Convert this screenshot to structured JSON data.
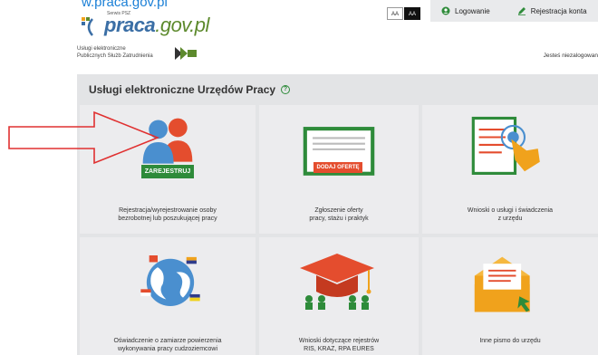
{
  "top_link": "w.praca.gov.pl",
  "logo": {
    "small_text": "Serwis PSZ",
    "brand_main": "praca",
    "brand_domain": ".gov.pl",
    "subtitle_line1": "Usługi elektroniczne",
    "subtitle_line2": "Publicznych Służb Zatrudnienia"
  },
  "font_size": {
    "normal": "AA",
    "contrast": "AA"
  },
  "topbar": {
    "login": "Logowanie",
    "register": "Rejestracja konta"
  },
  "status_text": "Jesteś niezalogowan",
  "panel": {
    "title": "Usługi elektroniczne Urzędów Pracy",
    "help_glyph": "?"
  },
  "tiles": [
    {
      "label": "Rejestracja/wyrejestrowanie osoby\nbezrobotnej lub poszukującej pracy",
      "button": "ZAREJESTRUJ"
    },
    {
      "label": "Zgłoszenie oferty\npracy, stażu i praktyk",
      "button": "DODAJ OFERTĘ"
    },
    {
      "label": "Wnioski o usługi i świadczenia\nz urzędu"
    },
    {
      "label": "Oświadczenie o zamiarze powierzenia\nwykonywania pracy cudzoziemcowi"
    },
    {
      "label": "Wnioski dotyczące rejestrów\nRIS, KRAZ, RPA EURES"
    },
    {
      "label": "Inne pismo do urzędu"
    }
  ],
  "colors": {
    "accent_green": "#2e8b3a",
    "orange": "#f0a21c",
    "red": "#e44d2e",
    "blue": "#4a8fcf",
    "arrow": "#e03030"
  }
}
